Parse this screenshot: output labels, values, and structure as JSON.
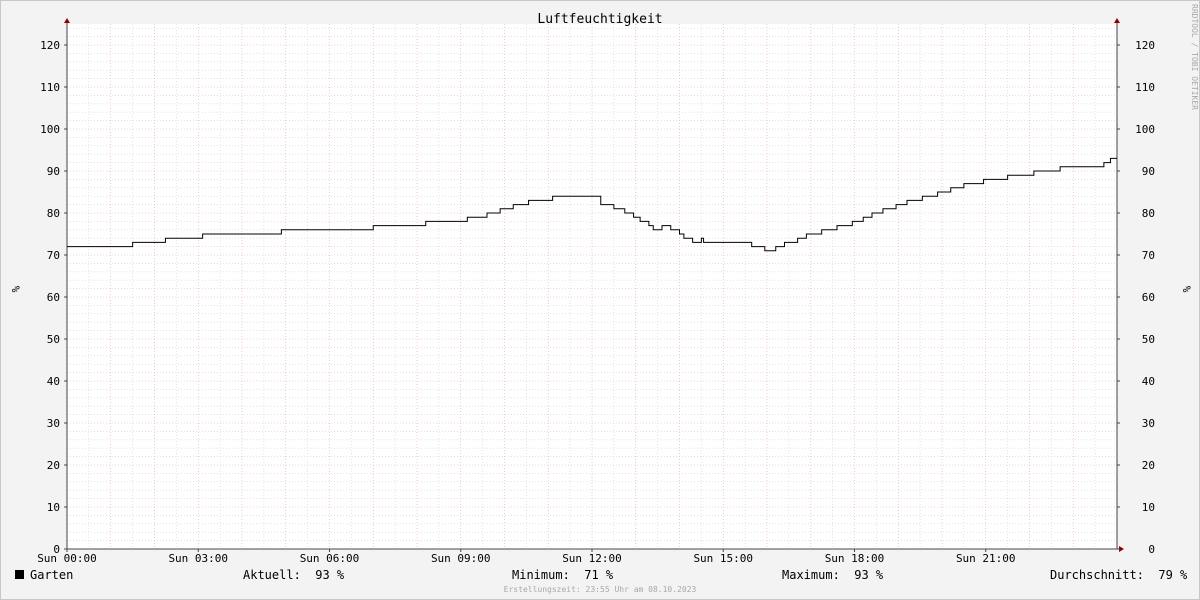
{
  "chart_data": {
    "type": "line",
    "title": "Luftfeuchtigkeit",
    "ylabel_left": "%",
    "ylabel_right": "%",
    "y_ticks": [
      0,
      10,
      20,
      30,
      40,
      50,
      60,
      70,
      80,
      90,
      100,
      110,
      120
    ],
    "x_tick_labels": [
      "Sun 00:00",
      "Sun 03:00",
      "Sun 06:00",
      "Sun 09:00",
      "Sun 12:00",
      "Sun 15:00",
      "Sun 18:00",
      "Sun 21:00"
    ],
    "x_range_hours": [
      0,
      24
    ],
    "ylim": [
      0,
      125
    ],
    "grid": true,
    "colors": {
      "line": "#000000",
      "major_grid": "#e8a3b4",
      "minor_grid": "#d2d2d2",
      "axis": "#8b0000"
    },
    "series": [
      {
        "name": "Garten",
        "x_hours": [
          0,
          1.5,
          2.25,
          3.1,
          3.5,
          4.9,
          7.0,
          8.2,
          9.15,
          9.6,
          9.9,
          10.0,
          10.2,
          10.55,
          11.1,
          12.2,
          12.5,
          12.75,
          12.95,
          13.1,
          13.3,
          13.4,
          13.6,
          13.8,
          14.0,
          14.1,
          14.3,
          14.5,
          14.55,
          14.75,
          15.65,
          15.95,
          16.2,
          16.4,
          16.7,
          16.9,
          17.25,
          17.6,
          17.95,
          18.2,
          18.4,
          18.65,
          18.95,
          19.2,
          19.55,
          19.9,
          20.2,
          20.5,
          20.95,
          21.5,
          22.1,
          22.7,
          23.7,
          23.85,
          24.0
        ],
        "values": [
          72,
          73,
          74,
          75,
          75,
          76,
          77,
          78,
          79,
          80,
          81,
          81,
          82,
          83,
          84,
          82,
          81,
          80,
          79,
          78,
          77,
          76,
          77,
          76,
          75,
          74,
          73,
          74,
          73,
          73,
          72,
          71,
          72,
          73,
          74,
          75,
          76,
          77,
          78,
          79,
          80,
          81,
          82,
          83,
          84,
          85,
          86,
          87,
          88,
          89,
          90,
          91,
          92,
          93,
          93
        ]
      }
    ]
  },
  "legend": {
    "series_name": "Garten",
    "current_label": "Aktuell:",
    "current_value": "93 %",
    "min_label": "Minimum:",
    "min_value": "71 %",
    "max_label": "Maximum:",
    "max_value": "93 %",
    "avg_label": "Durchschnitt:",
    "avg_value": "79 %"
  },
  "footer": "Erstellungszeit: 23:55 Uhr am 08.10.2023",
  "watermark": "RRDTOOL / TOBI OETIKER"
}
